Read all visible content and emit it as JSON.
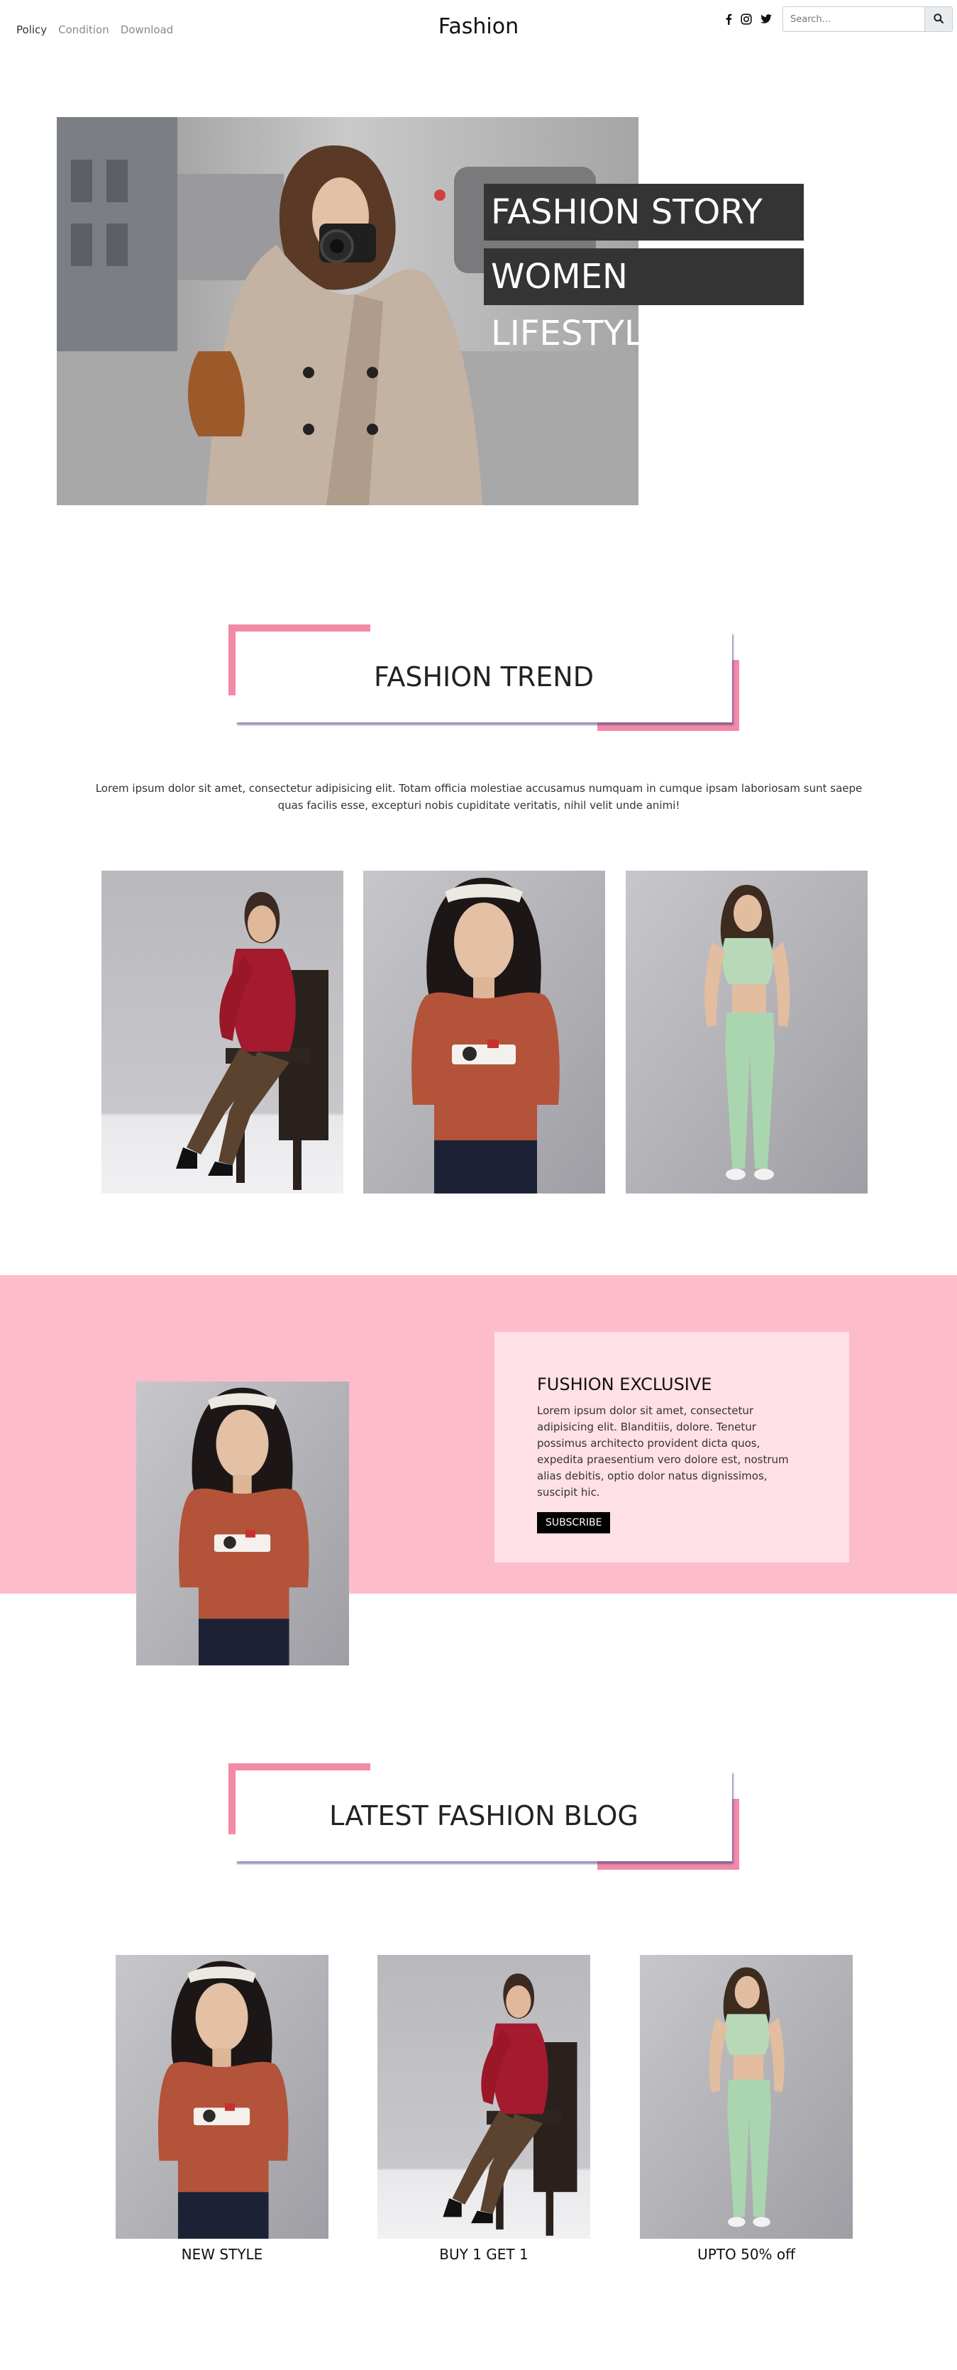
{
  "nav": {
    "links": [
      "Policy",
      "Condition",
      "Download"
    ],
    "brand": "Fashion",
    "social_icons": [
      "facebook-icon",
      "instagram-icon",
      "twitter-icon"
    ],
    "search_placeholder": "Search...",
    "search_icon": "search-icon"
  },
  "hero": {
    "line1": "FASHION STORY",
    "line2": "WOMEN LIFESTYLE"
  },
  "trend": {
    "title": "FASHION TREND",
    "intro": "Lorem ipsum dolor sit amet, consectetur adipisicing elit. Totam officia molestiae accusamus numquam in cumque ipsam laboriosam sunt saepe quas facilis esse, excepturi nobis cupiditate veritatis, nihil velit unde animi!"
  },
  "exclusive": {
    "title": "FUSHION EXCLUSIVE",
    "text": "Lorem ipsum dolor sit amet, consectetur adipisicing elit. Blanditiis, dolore. Tenetur possimus architecto provident dicta quos, expedita praesentium vero dolore est, nostrum alias debitis, optio dolor natus dignissimos, suscipit hic.",
    "button": "SUBSCRIBE"
  },
  "blog": {
    "title": "LATEST FASHION BLOG",
    "items": [
      {
        "caption": "NEW STYLE"
      },
      {
        "caption": "BUY 1 GET 1"
      },
      {
        "caption": "UPTO 50% off"
      }
    ]
  },
  "colors": {
    "hero_bg": "#f4f4fa",
    "accent_pink": "#f28aa6",
    "exclusive_bg": "#fdbccb",
    "card_bg": "#ffe0e6",
    "tag_bg": "#343434"
  }
}
